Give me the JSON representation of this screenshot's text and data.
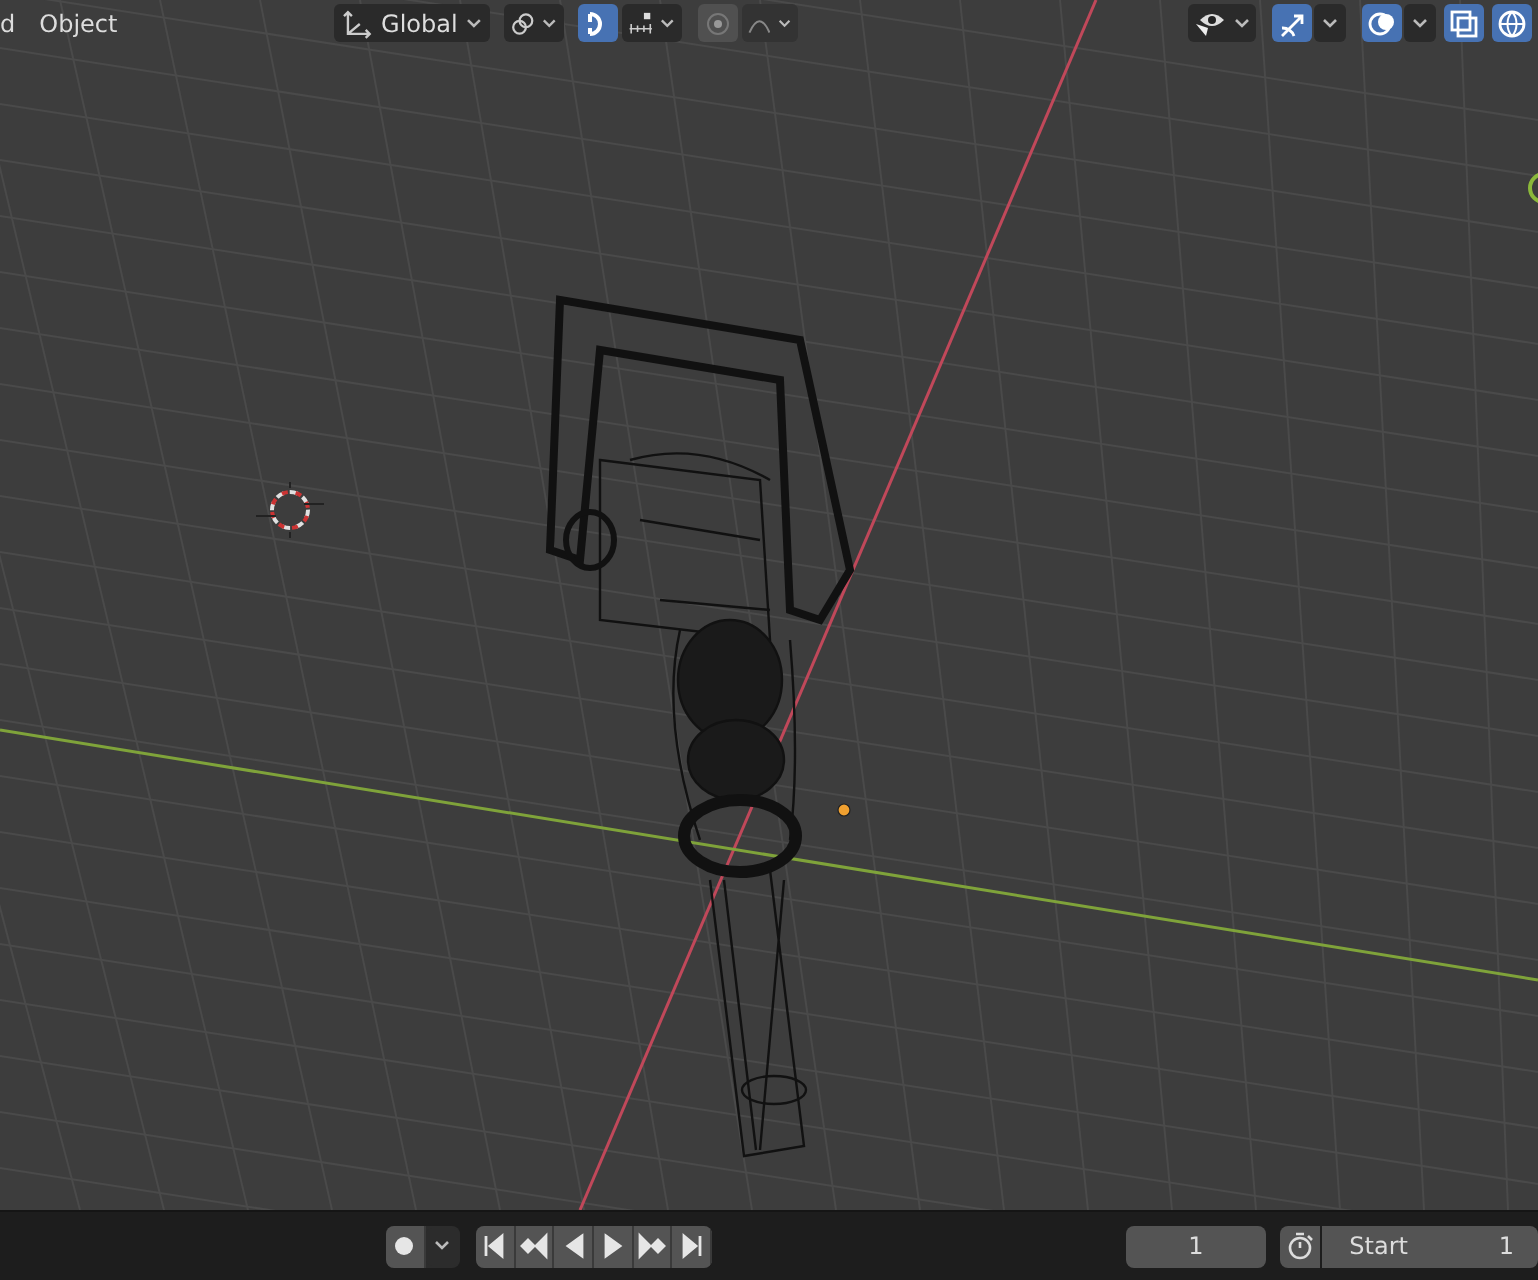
{
  "header": {
    "menus": [
      {
        "label": "d"
      },
      {
        "label": "Object"
      }
    ],
    "orientation": {
      "label": "Global"
    },
    "left_toggles": [
      {
        "kind": "snap",
        "on": true
      },
      {
        "kind": "proportional",
        "on": false
      }
    ],
    "right_toggles": [
      {
        "kind": "gizmo",
        "on": true
      },
      {
        "kind": "overlay",
        "on": true
      },
      {
        "kind": "xray",
        "on": true
      },
      {
        "kind": "globe",
        "on": true
      }
    ]
  },
  "timeline": {
    "current_frame": "1",
    "start": {
      "label": "Start",
      "value": "1"
    }
  }
}
